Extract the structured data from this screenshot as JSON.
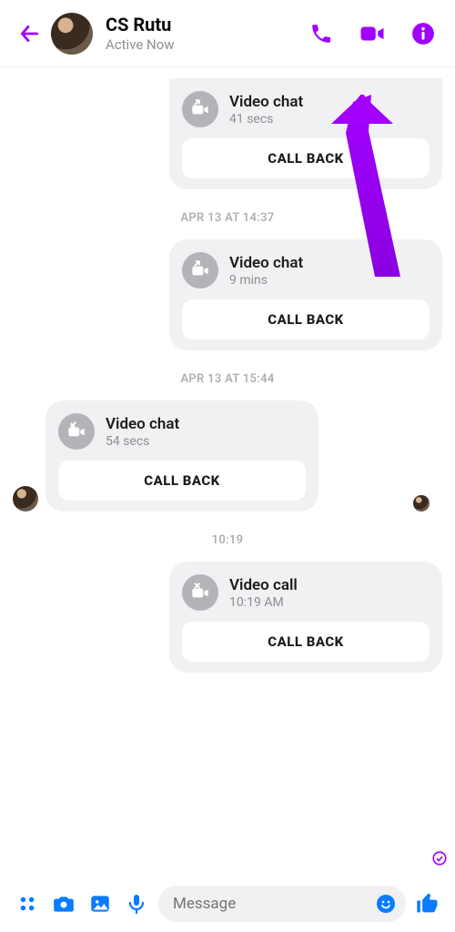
{
  "accent": "#a100ff",
  "composer_accent": "#0a7cff",
  "header": {
    "name": "CS Rutu",
    "status": "Active Now"
  },
  "thread": [
    {
      "type": "bubble",
      "side": "right",
      "partial_top": true,
      "icon": "video-out",
      "title": "Video chat",
      "subtitle": "41 secs",
      "call_back": "CALL BACK",
      "show_avatar": false
    },
    {
      "type": "timestamp",
      "text": "APR 13 AT 14:37"
    },
    {
      "type": "bubble",
      "side": "right",
      "partial_top": false,
      "icon": "video-out",
      "title": "Video chat",
      "subtitle": "9 mins",
      "call_back": "CALL BACK",
      "show_avatar": false
    },
    {
      "type": "timestamp",
      "text": "APR 13 AT 15:44"
    },
    {
      "type": "bubble",
      "side": "left",
      "partial_top": false,
      "icon": "video-in",
      "title": "Video chat",
      "subtitle": "54 secs",
      "call_back": "CALL BACK",
      "show_avatar": true,
      "trailing_mini": true
    },
    {
      "type": "timestamp",
      "text": "10:19"
    },
    {
      "type": "bubble",
      "side": "right",
      "partial_top": false,
      "icon": "video-missed",
      "title": "Video call",
      "subtitle": "10:19 AM",
      "call_back": "CALL BACK",
      "show_avatar": false
    }
  ],
  "composer": {
    "placeholder": "Message"
  }
}
